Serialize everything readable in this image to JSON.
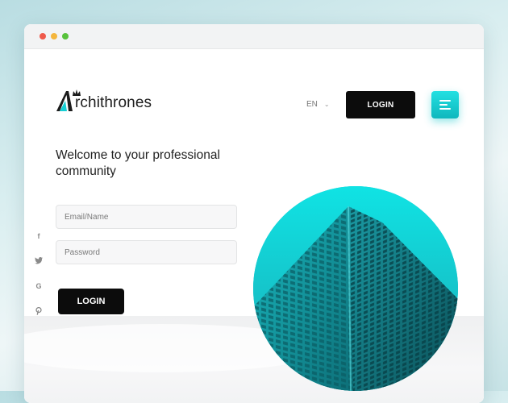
{
  "brand": {
    "name": "rchithrones",
    "logo_letter": "A"
  },
  "header": {
    "language": "EN",
    "login_label": "LOGIN",
    "menu_icon": "hamburger-icon"
  },
  "main": {
    "welcome": "Welcome to your professional community",
    "email_placeholder": "Email/Name",
    "password_placeholder": "Password",
    "login_label": "LOGIN"
  },
  "social": [
    {
      "name": "facebook-icon",
      "glyph": "f"
    },
    {
      "name": "twitter-icon",
      "glyph": ""
    },
    {
      "name": "google-icon",
      "glyph": "G"
    },
    {
      "name": "pinterest-icon",
      "glyph": ""
    }
  ],
  "colors": {
    "accent": "#16cfd4",
    "button_dark": "#0c0c0c",
    "window_controls": [
      "#ef5a4b",
      "#f4b63d",
      "#58c23c"
    ]
  },
  "hero_image": "teal-skyscraper-photo"
}
